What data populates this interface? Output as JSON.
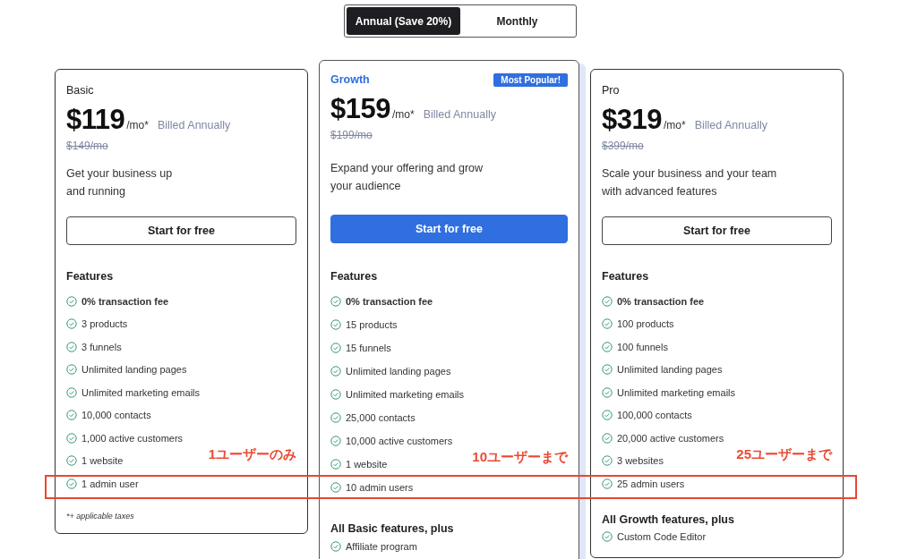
{
  "billing_toggle": [
    {
      "label": "Annual (Save 20%)",
      "selected": true
    },
    {
      "label": "Monthly",
      "selected": false
    }
  ],
  "plans": [
    {
      "name": "Basic",
      "featured": false,
      "price": "$119",
      "unit": "/mo*",
      "billing": "Billed Annually",
      "old_price": "$149/mo",
      "description": "Get your business up\nand running",
      "button": "Start for free",
      "features_title": "Features",
      "features": [
        {
          "text": "0% transaction fee",
          "bold": true
        },
        {
          "text": "3 products",
          "bold": false
        },
        {
          "text": "3 funnels",
          "bold": false
        },
        {
          "text": "Unlimited landing pages",
          "bold": false
        },
        {
          "text": "Unlimited marketing emails",
          "bold": false
        },
        {
          "text": "10,000 contacts",
          "bold": false
        },
        {
          "text": "1,000 active customers",
          "bold": false
        },
        {
          "text": "1 website",
          "bold": false,
          "note": "1ユーザーのみ"
        },
        {
          "text": "1 admin user",
          "bold": false
        }
      ],
      "footnote": "*+ applicable taxes"
    },
    {
      "name": "Growth",
      "featured": true,
      "badge": "Most Popular!",
      "price": "$159",
      "unit": "/mo*",
      "billing": "Billed Annually",
      "old_price": "$199/mo",
      "description": "Expand your offering and grow\nyour audience",
      "button": "Start for free",
      "features_title": "Features",
      "features": [
        {
          "text": "0% transaction fee",
          "bold": true
        },
        {
          "text": "15 products",
          "bold": false
        },
        {
          "text": "15 funnels",
          "bold": false
        },
        {
          "text": "Unlimited landing pages",
          "bold": false
        },
        {
          "text": "Unlimited marketing emails",
          "bold": false
        },
        {
          "text": "25,000 contacts",
          "bold": false
        },
        {
          "text": "10,000 active customers",
          "bold": false
        },
        {
          "text": "1 website",
          "bold": false,
          "note": "10ユーザーまで"
        },
        {
          "text": "10 admin users",
          "bold": false
        }
      ],
      "extra_title": "All Basic features, plus",
      "extra_features": [
        {
          "text": "Affiliate program",
          "bold": false
        }
      ]
    },
    {
      "name": "Pro",
      "featured": false,
      "price": "$319",
      "unit": "/mo*",
      "billing": "Billed Annually",
      "old_price": "$399/mo",
      "description": "Scale your business and your team\nwith advanced features",
      "button": "Start for free",
      "features_title": "Features",
      "features": [
        {
          "text": "0% transaction fee",
          "bold": true
        },
        {
          "text": "100 products",
          "bold": false
        },
        {
          "text": "100 funnels",
          "bold": false
        },
        {
          "text": "Unlimited landing pages",
          "bold": false
        },
        {
          "text": "Unlimited marketing emails",
          "bold": false
        },
        {
          "text": "100,000 contacts",
          "bold": false
        },
        {
          "text": "20,000 active customers",
          "bold": false
        },
        {
          "text": "3 websites",
          "bold": false,
          "note": "25ユーザーまで"
        },
        {
          "text": "25 admin users",
          "bold": false
        }
      ],
      "extra_title": "All Growth features, plus",
      "extra_features": [
        {
          "text": "Custom Code Editor",
          "bold": false
        }
      ]
    }
  ]
}
